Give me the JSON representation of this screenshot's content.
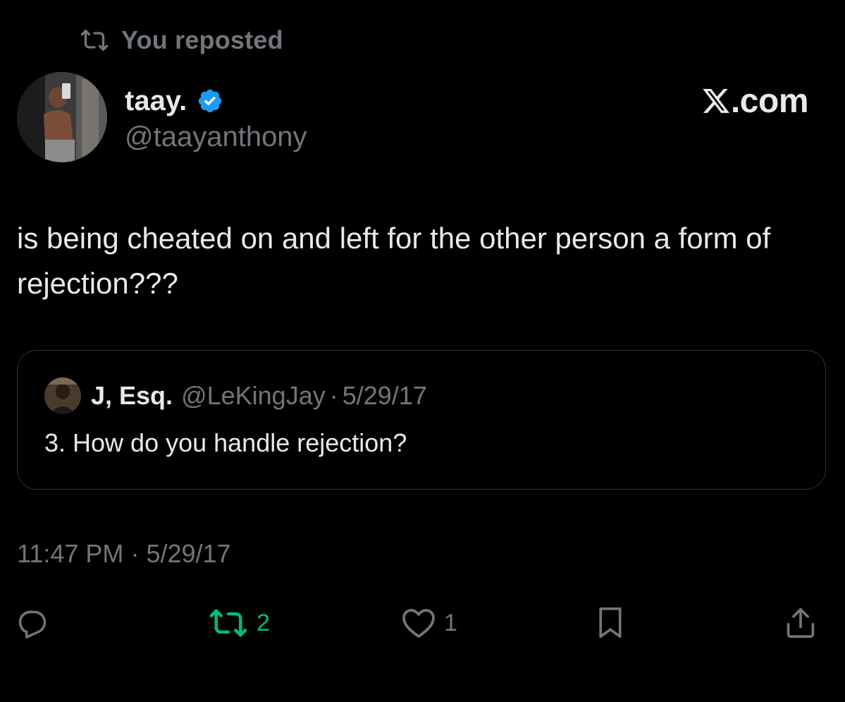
{
  "repost_banner": {
    "label": "You reposted",
    "icon": "repost-icon"
  },
  "author": {
    "name": "taay.",
    "handle": "@taayanthony",
    "verified": true,
    "verified_color": "#1d9bf0",
    "avatar_icon": "avatar"
  },
  "site": {
    "logo_text": ".com",
    "logo_icon": "x-logo-icon"
  },
  "tweet": {
    "text": "is being cheated on and left for the other person a form of rejection???"
  },
  "quoted": {
    "name": "J, Esq.",
    "handle": "@LeKingJay",
    "separator": "·",
    "date": "5/29/17",
    "text": "3. How do you handle rejection?"
  },
  "timestamp": {
    "time": "11:47 PM",
    "separator": "·",
    "date": "5/29/17"
  },
  "actions": {
    "reply": {
      "icon": "reply-icon",
      "count": ""
    },
    "repost": {
      "icon": "repost-icon",
      "count": "2",
      "active": true,
      "color": "#00ba7c"
    },
    "like": {
      "icon": "heart-icon",
      "count": "1"
    },
    "bookmark": {
      "icon": "bookmark-icon",
      "count": ""
    },
    "share": {
      "icon": "share-icon",
      "count": ""
    }
  },
  "colors": {
    "background": "#000000",
    "primary_text": "#e7e9ea",
    "secondary_text": "#71767b",
    "border": "#2f3336"
  }
}
